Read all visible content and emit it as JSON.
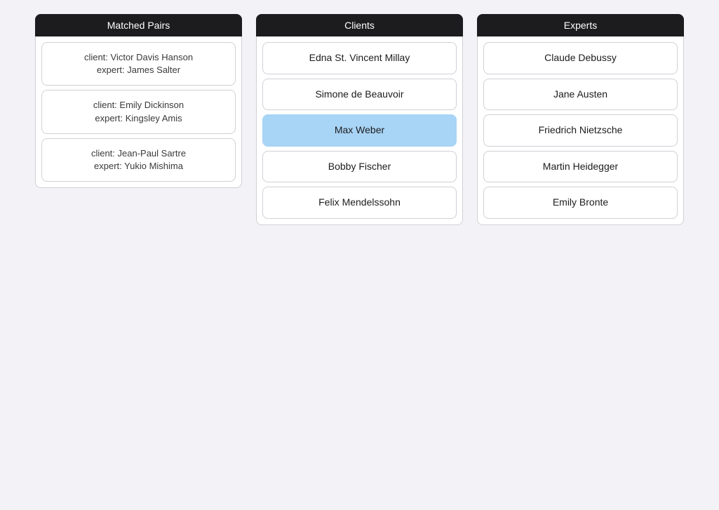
{
  "columns": {
    "matched_pairs": {
      "header": "Matched Pairs",
      "items": [
        {
          "client": "Victor Davis Hanson",
          "expert": "James Salter"
        },
        {
          "client": "Emily Dickinson",
          "expert": "Kingsley Amis"
        },
        {
          "client": "Jean-Paul Sartre",
          "expert": "Yukio Mishima"
        }
      ]
    },
    "clients": {
      "header": "Clients",
      "items": [
        "Edna St. Vincent Millay",
        "Simone de Beauvoir",
        "Max Weber",
        "Bobby Fischer",
        "Felix Mendelssohn"
      ],
      "selected_index": 2
    },
    "experts": {
      "header": "Experts",
      "items": [
        "Claude Debussy",
        "Jane Austen",
        "Friedrich Nietzsche",
        "Martin Heidegger",
        "Emily Bronte"
      ]
    }
  }
}
